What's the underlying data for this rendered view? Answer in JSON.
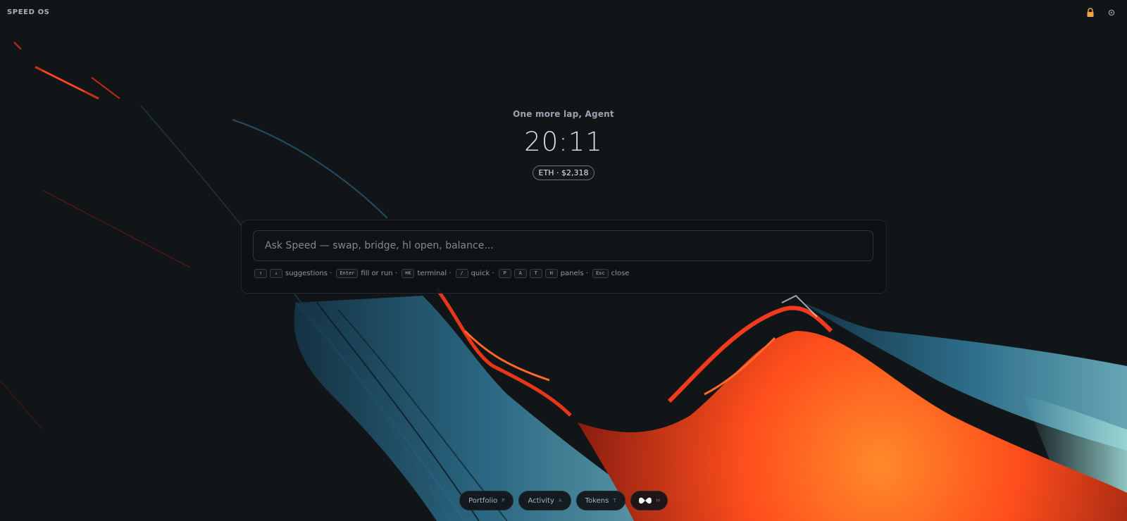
{
  "app": {
    "brand": "SPEED OS"
  },
  "topbar": {
    "icons": [
      "lock-icon",
      "settings-icon"
    ],
    "lock_color": "#f2a14a"
  },
  "hero": {
    "greeting": "One more lap, Agent",
    "time": "20:11",
    "price_badge": "ETH · $2,318"
  },
  "command": {
    "placeholder": "Ask Speed — swap, bridge, hl open, balance...",
    "value": "",
    "hints": {
      "up_key": "↑",
      "down_key": "↓",
      "suggestions": "suggestions ·",
      "enter_key": "Enter",
      "fill_run": "fill or run ·",
      "cmd_key": "⌘K",
      "terminal": "terminal ·",
      "slash_key": "/",
      "quick": "quick ·",
      "p_key": "P",
      "a_key": "A",
      "t_key": "T",
      "h_key": "H",
      "panels": "panels ·",
      "esc_key": "Esc",
      "close": "close"
    }
  },
  "dock": {
    "items": [
      {
        "label": "Portfolio",
        "key": "P"
      },
      {
        "label": "Activity",
        "key": "A"
      },
      {
        "label": "Tokens",
        "key": "T"
      },
      {
        "label": "",
        "key": "H",
        "icon": "hyperliquid-logo-icon"
      }
    ]
  },
  "theme": {
    "background": "#121518",
    "accent_orange": "#ff5a1f",
    "accent_blue": "#2f6f8c"
  }
}
